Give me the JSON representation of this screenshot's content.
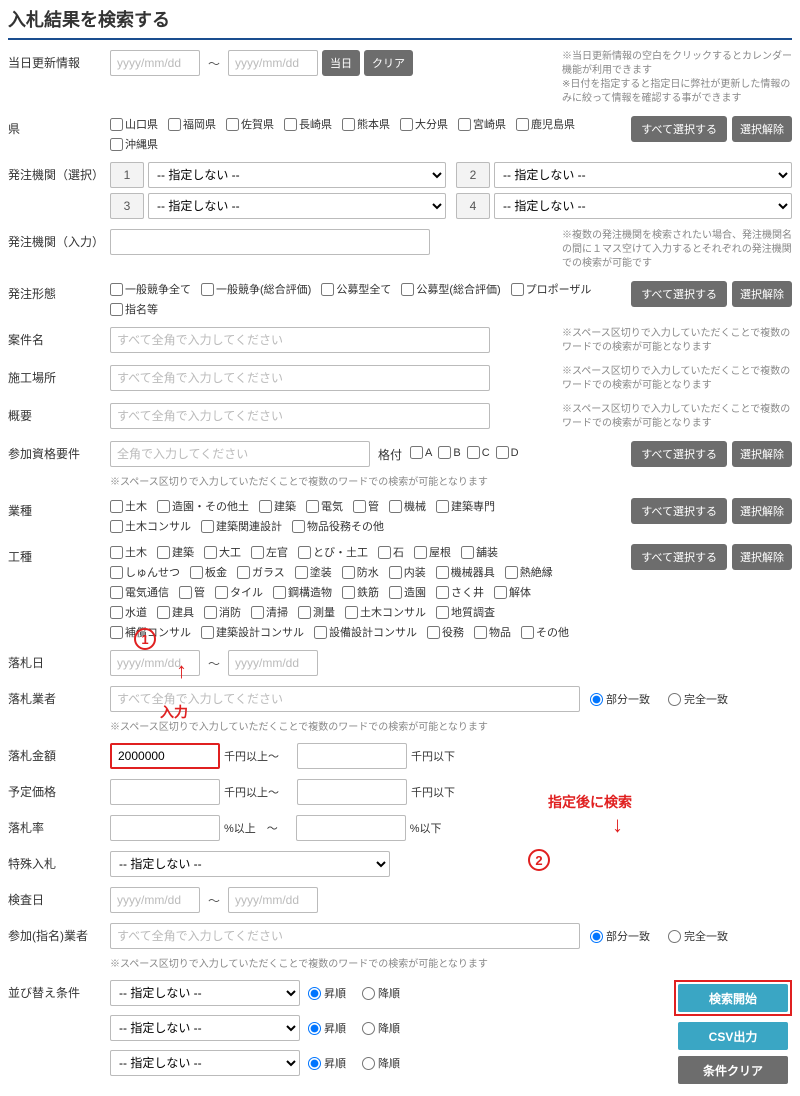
{
  "title": "入札結果を検索する",
  "date_ph": "yyyy/mm/dd",
  "today_update": {
    "label": "当日更新情報",
    "btn_today": "当日",
    "btn_clear": "クリア",
    "note": "※当日更新情報の空白をクリックするとカレンダー機能が利用できます\n※日付を指定すると指定日に弊社が更新した情報のみに絞って情報を確認する事ができます"
  },
  "pref": {
    "label": "県",
    "items": [
      "山口県",
      "福岡県",
      "佐賀県",
      "長崎県",
      "熊本県",
      "大分県",
      "宮崎県",
      "鹿児島県",
      "沖縄県"
    ],
    "select_all": "すべて選択する",
    "deselect": "選択解除"
  },
  "org_sel": {
    "label": "発注機関（選択）",
    "opt": "-- 指定しない --"
  },
  "org_in": {
    "label": "発注機関（入力）",
    "note": "※複数の発注機関を検索されたい場合、発注機関名の間に１マス空けて入力するとそれぞれの発注機関での検索が可能です"
  },
  "form": {
    "label": "発注形態",
    "items": [
      "一般競争全て",
      "一般競争(総合評価)",
      "公募型全て",
      "公募型(総合評価)",
      "プロポーザル",
      "指名等"
    ]
  },
  "proj": {
    "label": "案件名",
    "ph": "すべて全角で入力してください",
    "note": "※スペース区切りで入力していただくことで複数のワードでの検索が可能となります"
  },
  "loc": {
    "label": "施工場所"
  },
  "summary": {
    "label": "概要"
  },
  "qual": {
    "label": "参加資格要件",
    "ph": "全角で入力してください",
    "rank": "格付",
    "ranks": [
      "A",
      "B",
      "C",
      "D"
    ]
  },
  "hint_multi": "※スペース区切りで入力していただくことで複数のワードでの検索が可能となります",
  "ind": {
    "label": "業種",
    "items": [
      "土木",
      "造園・その他土",
      "建築",
      "電気",
      "管",
      "機械",
      "建築専門",
      "土木コンサル",
      "建築関連設計",
      "物品役務その他"
    ]
  },
  "work": {
    "label": "工種",
    "items": [
      "土木",
      "建築",
      "大工",
      "左官",
      "とび・土工",
      "石",
      "屋根",
      "舗装",
      "しゅんせつ",
      "板金",
      "ガラス",
      "塗装",
      "防水",
      "内装",
      "機械器具",
      "熱絶縁",
      "電気通信",
      "管",
      "タイル",
      "鋼構造物",
      "鉄筋",
      "造園",
      "さく井",
      "解体",
      "水道",
      "建具",
      "消防",
      "清掃",
      "測量",
      "土木コンサル",
      "地質調査",
      "補償コンサル",
      "建築設計コンサル",
      "設備設計コンサル",
      "役務",
      "物品",
      "その他"
    ]
  },
  "award_date": {
    "label": "落札日"
  },
  "bidder": {
    "label": "落札業者",
    "partial": "部分一致",
    "exact": "完全一致"
  },
  "amount": {
    "label": "落札金額",
    "val": "2000000",
    "unit_from": "千円以上～",
    "unit_to": "千円以下"
  },
  "est": {
    "label": "予定価格"
  },
  "rate": {
    "label": "落札率",
    "pf": "%以上　～",
    "pt": "%以下"
  },
  "special": {
    "label": "特殊入札",
    "opt": "-- 指定しない --"
  },
  "insp": {
    "label": "検査日"
  },
  "nominee": {
    "label": "参加(指名)業者"
  },
  "sort": {
    "label": "並び替え条件",
    "opt": "-- 指定しない --",
    "asc": "昇順",
    "desc": "降順"
  },
  "actions": {
    "search": "検索開始",
    "csv": "CSV出力",
    "clear": "条件クリア"
  },
  "ann": {
    "input": "入力",
    "after": "指定後に検索"
  }
}
